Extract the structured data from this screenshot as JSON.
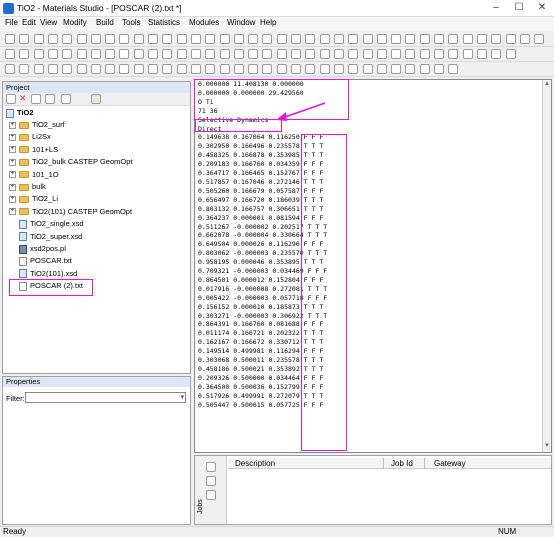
{
  "window": {
    "title": "TiO2 - Materials Studio - [POSCAR (2).txt *]",
    "controls": [
      "–",
      "☐",
      "✕"
    ]
  },
  "menu": [
    "File",
    "Edit",
    "View",
    "Modify",
    "Build",
    "Tools",
    "Statistics",
    "Modules",
    "Window",
    "Help"
  ],
  "project": {
    "header": "Project",
    "root": "TiO2",
    "items": [
      {
        "label": "TiO2_surf",
        "type": "folder"
      },
      {
        "label": "Li2Sx",
        "type": "folder"
      },
      {
        "label": "101+LS",
        "type": "folder"
      },
      {
        "label": "TiO2_bulk CASTEP GeomOpt",
        "type": "folder"
      },
      {
        "label": "101_1O",
        "type": "folder"
      },
      {
        "label": "bulk",
        "type": "folder"
      },
      {
        "label": "TiO2_Li",
        "type": "folder"
      },
      {
        "label": "TiO2(101) CASTEP GeomOpt",
        "type": "folder"
      },
      {
        "label": "TiO2_single.xsd",
        "type": "xsd"
      },
      {
        "label": "TiO2_super.xsd",
        "type": "xsd"
      },
      {
        "label": "xsd2pos.pl",
        "type": "pl"
      },
      {
        "label": "POSCAR.txt",
        "type": "txt"
      },
      {
        "label": "TiO2(101).xsd",
        "type": "xsd"
      },
      {
        "label": "POSCAR (2).txt",
        "type": "txt"
      }
    ]
  },
  "properties": {
    "header": "Properties",
    "filter_label": "Filter:"
  },
  "editor": {
    "lines": [
      "0.000000 11.408130 0.000000",
      "0.000000 0.000000 29.429560",
      "O Ti",
      "71 36",
      "Selective Dynamics",
      "Direct",
      "0.149638 0.167064 0.116250 F F F",
      "0.302950 0.166496 0.235578 T T T",
      "0.458325 0.166878 0.353985 T T T",
      "0.209183 0.166760 0.034359 F F F",
      "0.364717 0.166465 0.152767 F F F",
      "0.517857 0.167046 0.272146 T T T",
      "0.505260 0.166679 0.057587 F F F",
      "0.656497 0.166720 0.186039 T T T",
      "0.803132 0.166757 0.306651 T T T",
      "0.364237 0.000001 0.081594 F F F",
      "0.511267 -0.000002 0.202517 T T T",
      "0.662078 -0.000004 0.330664 T T T",
      "0.649504 0.000026 0.116290 F F F",
      "0.803062 -0.000003 0.235570 T T T",
      "0.958195 0.000046 0.353895 T T T",
      "0.709321 -0.000003 0.034469 F F F",
      "0.864501 0.000012 0.152804 F F F",
      "0.017916 -0.000008 0.272081 T T T",
      "0.005422 -0.000003 0.057718 F F F",
      "0.156152 0.000010 0.185873 T T T",
      "0.303271 -0.000003 0.306922 T T T",
      "0.864391 0.166760 0.081688 F F F",
      "0.011174 0.166721 0.202322 T T T",
      "0.162167 0.166672 0.330712 T T T",
      "0.149514 0.499981 0.116294 F F F",
      "0.303068 0.500011 0.235578 T T T",
      "0.458186 0.500021 0.353892 T T T",
      "0.209326 0.500000 0.034464 F F F",
      "0.364500 0.500036 0.152799 F F F",
      "0.517926 0.499991 0.272079 T T T",
      "0.505447 0.500015 0.057725 F F F"
    ]
  },
  "jobs": {
    "side_label": "Jobs",
    "columns": [
      "Description",
      "Job Id",
      "Gateway"
    ]
  },
  "status": {
    "left": "Ready",
    "right": "NUM"
  },
  "colors": {
    "annotation": "#e019d9",
    "selection": "#c5d9f1"
  }
}
